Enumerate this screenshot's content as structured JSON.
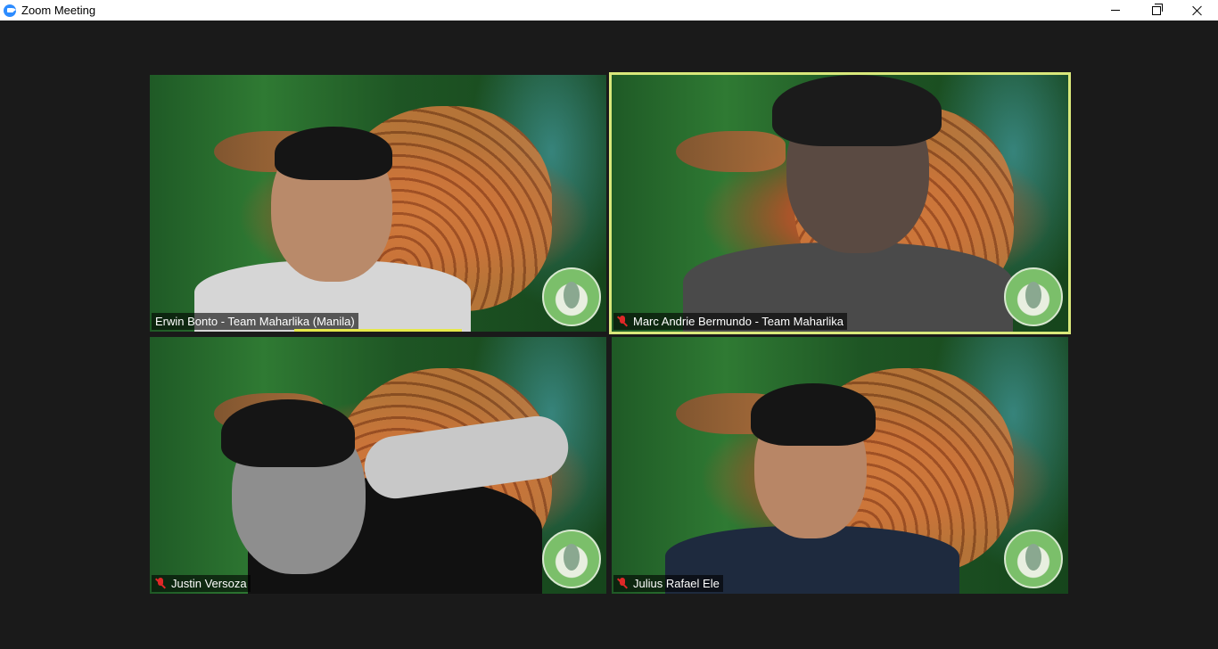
{
  "window": {
    "title": "Zoom Meeting",
    "icon": "zoom-camera-icon",
    "controls": [
      "minimize-icon",
      "restore-icon",
      "close-icon"
    ]
  },
  "colors": {
    "background": "#1a1a1a",
    "active_speaker_border": "#d9e87b",
    "mute_icon": "#e02828",
    "zoom_blue": "#2d8cff"
  },
  "participants": [
    {
      "name": "Erwin Bonto - Team Maharlika (Manila)",
      "muted": false,
      "speaking": true
    },
    {
      "name": "Marc Andrie Bermundo - Team Maharlika",
      "muted": true,
      "active_speaker": true
    },
    {
      "name": "Justin Versoza",
      "muted": true
    },
    {
      "name": "Julius Rafael Ele",
      "muted": true
    }
  ]
}
